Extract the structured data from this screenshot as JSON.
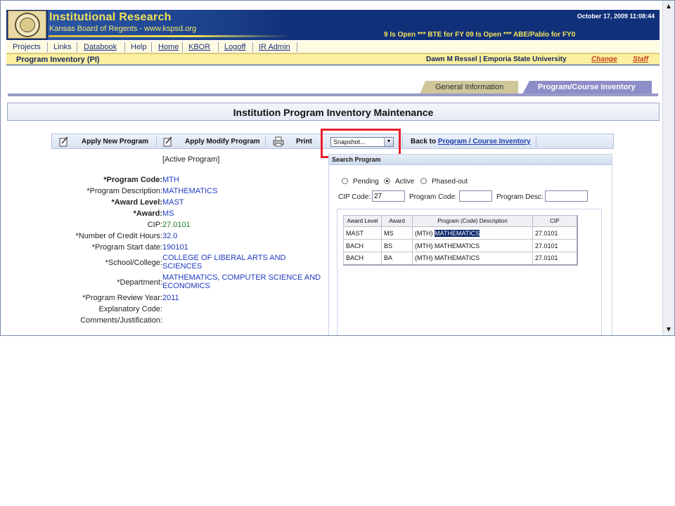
{
  "header": {
    "title": "Institutional Research",
    "subtitle": "Kansas Board of Regents - www.kspsd.org",
    "datetime": "October 17, 2009 11:08:44",
    "ticker": "9  Is Open *** BTE for FY 09 Is Open *** ABE/Pablo for FY0"
  },
  "nav": {
    "items": [
      "Projects",
      "Links",
      "Databook",
      "Help",
      "Home",
      "KBOR",
      "Logoff",
      "IR Admin"
    ]
  },
  "userbar": {
    "page_name": "Program Inventory (PI)",
    "user": "Dawn M Ressel  | Emporia State University",
    "change_link": "Change",
    "staff_link": "Staff"
  },
  "tabs": {
    "general": "General Information",
    "inventory": "Program/Course Inventory"
  },
  "page_title": "Institution Program Inventory Maintenance",
  "toolbar": {
    "apply_new": "Apply New Program",
    "apply_modify": "Apply Modify Program",
    "print": "Print",
    "snapshot_value": "Snapshot...",
    "back_prefix": "Back to ",
    "back_link": "Program / Course Inventory"
  },
  "form": {
    "status": "[Active Program]",
    "rows": [
      {
        "label": "*Program Code:",
        "value": "MTH"
      },
      {
        "label": "*Program Description:",
        "value": "MATHEMATICS"
      },
      {
        "label": "*Award Level:",
        "value": "MAST"
      },
      {
        "label": "*Award:",
        "value": "MS"
      },
      {
        "label": "CIP:",
        "value": "27.0101"
      },
      {
        "label": "*Number of Credit Hours:",
        "value": "32.0"
      },
      {
        "label": "*Program Start date:",
        "value": "190101"
      },
      {
        "label": "*School/College:",
        "value": "COLLEGE OF LIBERAL ARTS AND SCIENCES"
      },
      {
        "label": "*Department:",
        "value": "MATHEMATICS, COMPUTER SCIENCE AND ECONOMICS"
      },
      {
        "label": "*Program Review Year:",
        "value": "2011"
      },
      {
        "label": "Explanatory Code:",
        "value": ""
      },
      {
        "label": "Comments/Justification:",
        "value": ""
      }
    ]
  },
  "search": {
    "title": "Search Program",
    "radios": [
      {
        "label": "Pending",
        "selected": false
      },
      {
        "label": "Active",
        "selected": true
      },
      {
        "label": "Phased-out",
        "selected": false
      }
    ],
    "cip_label": "CIP Code:",
    "cip_value": "27",
    "program_code_label": "Program Code:",
    "program_code_value": "",
    "program_desc_label": "Program Desc:",
    "program_desc_value": ""
  },
  "results": {
    "columns": [
      "Award Level",
      "Award",
      "Program (Code) Description",
      "CIP"
    ],
    "rows": [
      {
        "award_level": "MAST",
        "award": "MS",
        "code": "(MTH) ",
        "desc": "MATHEMATICS",
        "cip": "27.0101"
      },
      {
        "award_level": "BACH",
        "award": "BS",
        "code": "(MTH) ",
        "desc": "MATHEMATICS",
        "cip": "27.0101"
      },
      {
        "award_level": "BACH",
        "award": "BA",
        "code": "(MTH) ",
        "desc": "MATHEMATICS",
        "cip": "27.0101"
      }
    ]
  },
  "colors": {
    "header_bg": "#11307a",
    "header_title": "#f3e25a",
    "userbar_bg": "#fcef9e",
    "tab_active": "#8d8dc8",
    "tab_inactive": "#cfc79a",
    "link_blue": "#1c3fae",
    "value_blue": "#1f38c0",
    "cip_green": "#1a7a2a",
    "highlight_red": "#e8202a"
  }
}
